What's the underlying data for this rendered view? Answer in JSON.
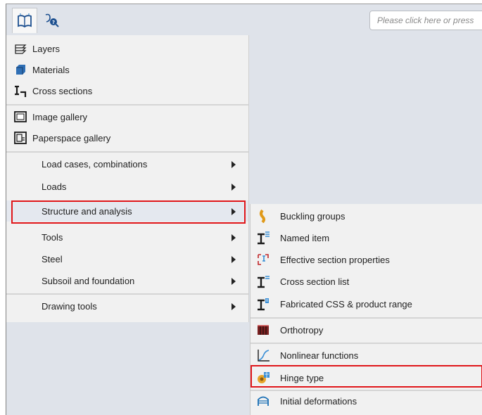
{
  "toolbar": {
    "main_icon": "book-icon",
    "help_icon": "search-help-icon",
    "command_placeholder": "Please click here or press"
  },
  "main_menu": {
    "items": [
      {
        "label": "Layers",
        "icon": "layers-icon"
      },
      {
        "label": "Materials",
        "icon": "materials-icon"
      },
      {
        "label": "Cross sections",
        "icon": "cross-section-icon"
      },
      {
        "label": "Image gallery",
        "icon": "image-gallery-icon"
      },
      {
        "label": "Paperspace gallery",
        "icon": "paperspace-gallery-icon"
      },
      {
        "label": "Load cases, combinations",
        "has_submenu": true
      },
      {
        "label": "Loads",
        "has_submenu": true
      },
      {
        "label": "Structure and analysis",
        "has_submenu": true,
        "highlighted": true
      },
      {
        "label": "Tools",
        "has_submenu": true
      },
      {
        "label": "Steel",
        "has_submenu": true
      },
      {
        "label": "Subsoil and foundation",
        "has_submenu": true
      },
      {
        "label": "Drawing tools",
        "has_submenu": true
      }
    ]
  },
  "submenu": {
    "items": [
      {
        "label": "Buckling groups",
        "icon": "buckling-groups-icon"
      },
      {
        "label": "Named item",
        "icon": "named-item-icon"
      },
      {
        "label": "Effective section properties",
        "icon": "effective-section-icon"
      },
      {
        "label": "Cross section list",
        "icon": "cross-section-list-icon"
      },
      {
        "label": "Fabricated CSS & product range",
        "icon": "fabricated-css-icon"
      },
      {
        "label": "Orthotropy",
        "icon": "orthotropy-icon"
      },
      {
        "label": "Nonlinear functions",
        "icon": "nonlinear-functions-icon"
      },
      {
        "label": "Hinge type",
        "icon": "hinge-type-icon",
        "highlighted": true
      },
      {
        "label": "Initial deformations",
        "icon": "initial-deformations-icon"
      }
    ]
  },
  "colors": {
    "highlight_border": "#e0161a",
    "menu_bg": "#f1f1f1",
    "frame_bg": "#dfe3ea"
  }
}
